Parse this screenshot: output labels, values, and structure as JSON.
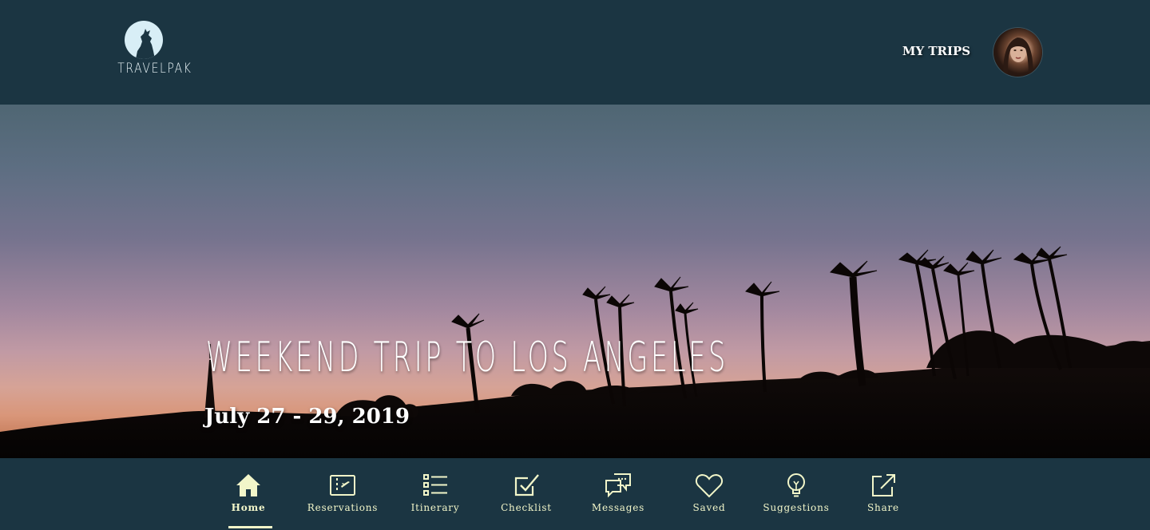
{
  "header": {
    "logo_text": "TRAVELPAK",
    "my_trips_label": "MY TRIPS",
    "logo_icon": "howling-wolf-moon-icon",
    "avatar_icon": "user-avatar"
  },
  "hero": {
    "title": "WEEKEND TRIP TO LOS ANGELES",
    "dates": "July 27 - 29, 2019"
  },
  "nav": {
    "items": [
      {
        "label": "Home",
        "icon": "home-icon",
        "active": true
      },
      {
        "label": "Reservations",
        "icon": "ticket-plane-icon",
        "active": false
      },
      {
        "label": "Itinerary",
        "icon": "list-icon",
        "active": false
      },
      {
        "label": "Checklist",
        "icon": "checkbox-icon",
        "active": false
      },
      {
        "label": "Messages",
        "icon": "chat-bubbles-icon",
        "active": false
      },
      {
        "label": "Saved",
        "icon": "heart-icon",
        "active": false
      },
      {
        "label": "Suggestions",
        "icon": "lightbulb-icon",
        "active": false
      },
      {
        "label": "Share",
        "icon": "share-icon",
        "active": false
      }
    ]
  },
  "colors": {
    "header_bg": "#1b3542",
    "nav_accent": "#f2f6c9",
    "text_white": "#ffffff"
  }
}
